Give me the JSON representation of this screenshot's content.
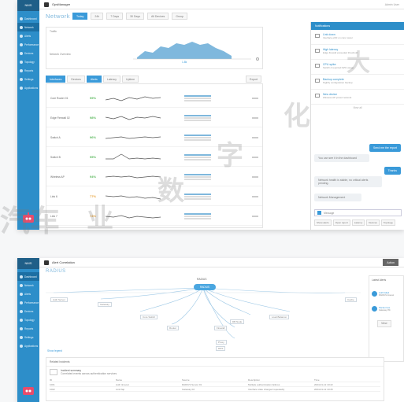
{
  "colors": {
    "sidebar": "#2d8ec9",
    "accent": "#3a9ad9",
    "good": "#5bb85d",
    "warn": "#e8a23a"
  },
  "shot1": {
    "sidebar_brand": "NMS",
    "sidebar_items": [
      {
        "label": "Dashboard",
        "icon": "home-icon"
      },
      {
        "label": "Network",
        "icon": "network-icon"
      },
      {
        "label": "Alerts",
        "icon": "bell-icon"
      },
      {
        "label": "Performance",
        "icon": "chart-icon"
      },
      {
        "label": "Devices",
        "icon": "server-icon"
      },
      {
        "label": "Topology",
        "icon": "topology-icon"
      },
      {
        "label": "Reports",
        "icon": "report-icon"
      },
      {
        "label": "Settings",
        "icon": "gear-icon"
      },
      {
        "label": "Applications",
        "icon": "app-icon"
      }
    ],
    "app_name": "OpsManager",
    "topbar_right": "Admin User",
    "page_title": "Network",
    "filter_pills": [
      "Today",
      "24h",
      "7 Days",
      "30 Days"
    ],
    "filter_selects": [
      "All Devices",
      "Group"
    ],
    "overview_label": "Traffic",
    "overview_left_label": "Network Overview",
    "overview_tick": "1.8k",
    "tabs": [
      "Interfaces",
      "Devices",
      "Alerts",
      "Latency",
      "Uptime"
    ],
    "export_label": "Export",
    "rows": [
      {
        "name": "Core Router 01",
        "value": "99%",
        "status": "good"
      },
      {
        "name": "Edge Firewall 02",
        "value": "98%",
        "status": "good"
      },
      {
        "name": "Switch A",
        "value": "96%",
        "status": "good"
      },
      {
        "name": "Switch B",
        "value": "95%",
        "status": "good"
      },
      {
        "name": "Wireless AP",
        "value": "94%",
        "status": "good"
      },
      {
        "name": "Link 6",
        "value": "77%",
        "status": "warn"
      },
      {
        "name": "Link 7",
        "value": "74%",
        "status": "warn"
      }
    ],
    "chat": {
      "header": "Notifications",
      "notifications": [
        {
          "title": "Link down",
          "body": "Interface eth0 on core router"
        },
        {
          "title": "High latency",
          "body": "Edge firewall exceeded threshold"
        },
        {
          "title": "CPU spike",
          "body": "Switch A reported 92% usage"
        },
        {
          "title": "Backup complete",
          "body": "Nightly configuration backup"
        },
        {
          "title": "New device",
          "body": "Wireless AP joined network"
        }
      ],
      "view_all": "View all",
      "messages": [
        {
          "from": "me",
          "text": "Send me the report"
        },
        {
          "from": "them",
          "text": "You can see it in the dashboard"
        },
        {
          "from": "me",
          "text": "Thanks"
        },
        {
          "from": "them",
          "text": "Network health is stable, no critical alerts pending."
        }
      ],
      "attachment": "Network Management",
      "input_placeholder": "Message",
      "quick_replies": [
        "Show alerts",
        "Open report",
        "Latency",
        "Devices",
        "Topology"
      ]
    }
  },
  "shot2": {
    "app_name": "Alert Correlation",
    "page_title": "RADIUS",
    "top_button": "Action",
    "root_node": "RADIUS",
    "child_nodes": [
      "Auth Server",
      "Gateway",
      "Core Switch",
      "Router",
      "Firewall",
      "DB Node",
      "Load Balancer",
      "Cache",
      "Proxy",
      "DNS"
    ],
    "legend_link": "Show legend",
    "panel_title": "Latest Alerts",
    "alerts": [
      {
        "title": "Auth failed",
        "body": "RADIUS timeout"
      },
      {
        "title": "Packet loss",
        "body": "Gateway 3%"
      }
    ],
    "panel_button": "View",
    "bottom_title": "Related Incidents",
    "incident_title": "Incident summary",
    "incident_body": "Correlated events across authentication services",
    "table_headers": [
      "ID",
      "Name",
      "Source",
      "Description",
      "Time"
    ],
    "table_rows": [
      [
        "1001",
        "Auth timeout",
        "RADIUS Server 01",
        "Multiple authentication failures",
        "2024-01-12 10:22"
      ],
      [
        "1002",
        "Link flap",
        "Gateway 02",
        "Interface state changed repeatedly",
        "2024-01-12 10:25"
      ]
    ]
  },
  "watermark": [
    "汽车",
    "业",
    "数",
    "字",
    "化",
    "大"
  ]
}
